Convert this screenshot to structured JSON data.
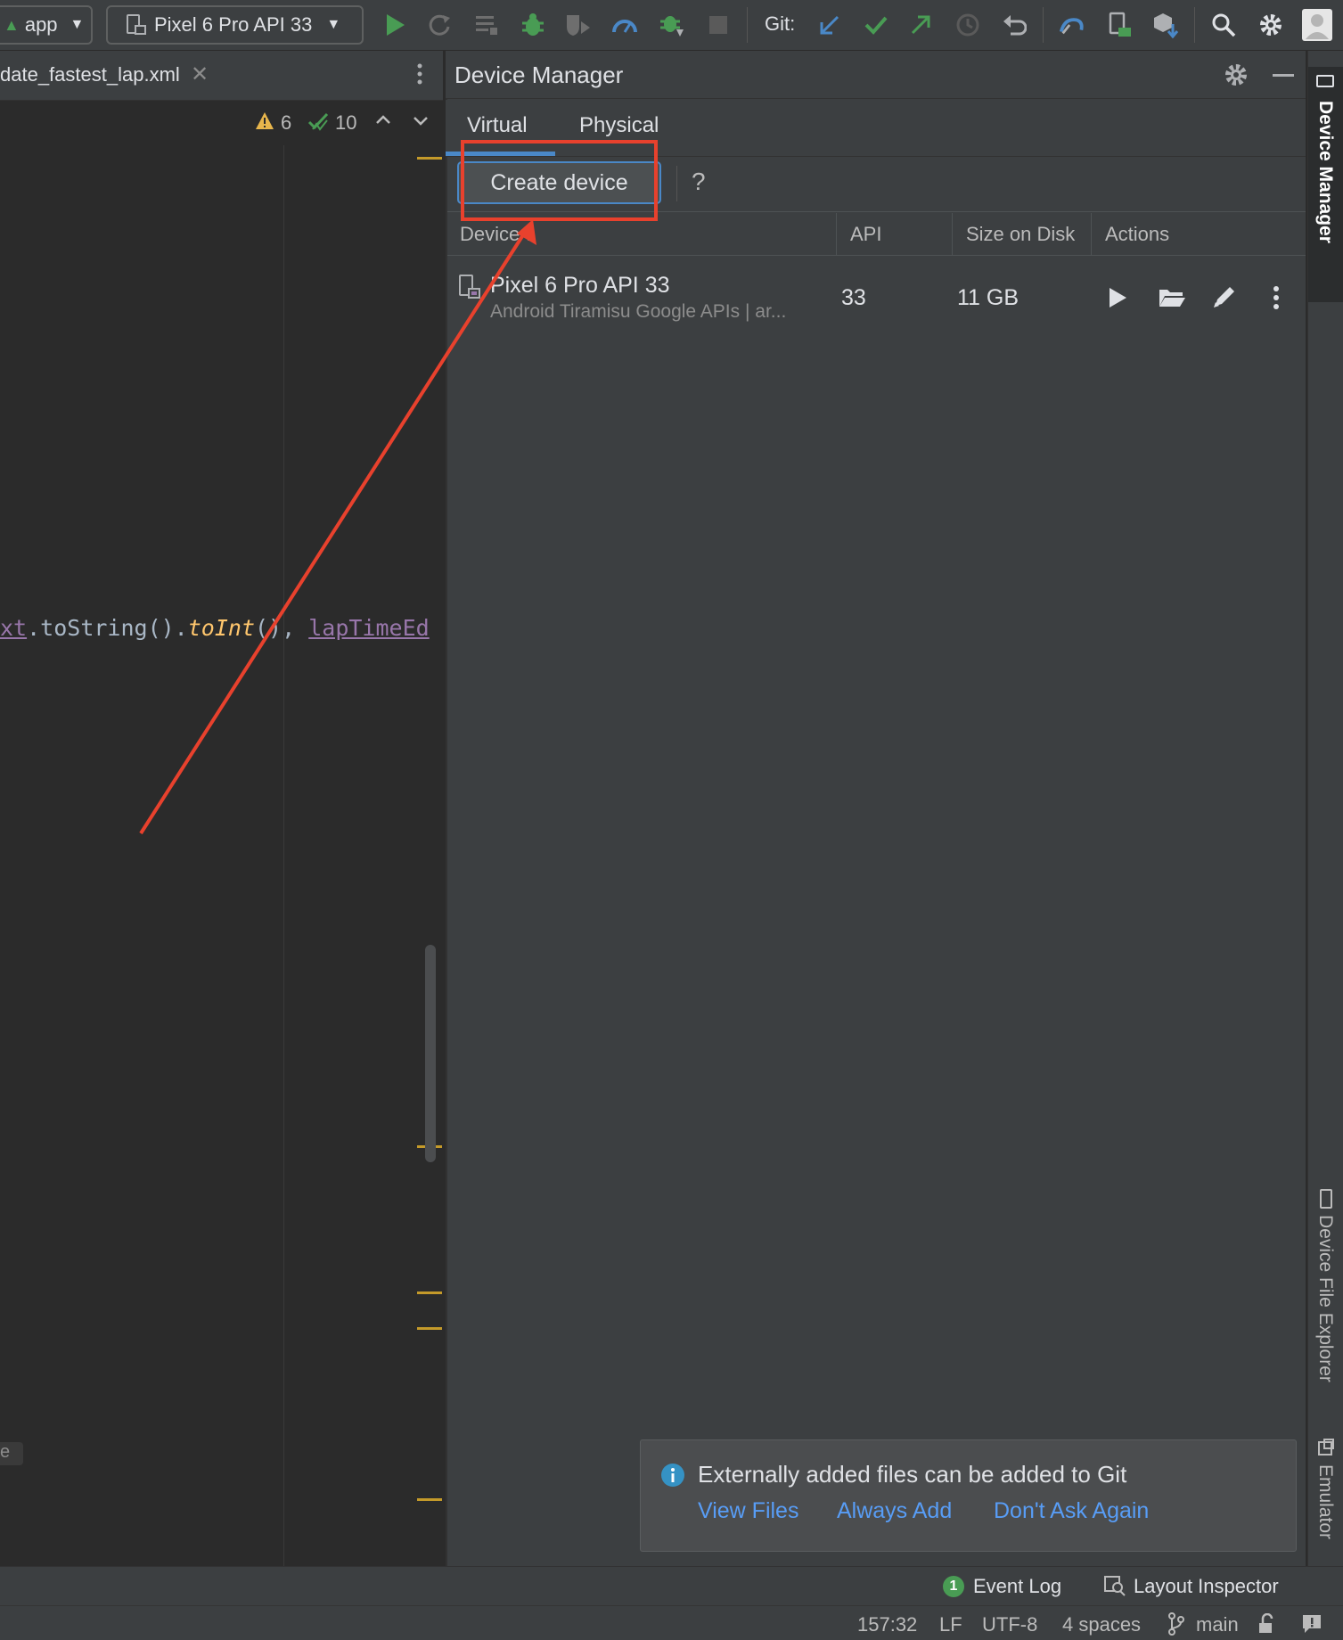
{
  "toolbar": {
    "run_config": "app",
    "device_combo": "Pixel 6 Pro API 33",
    "git_label": "Git:"
  },
  "editor": {
    "file_tab": "date_fastest_lap.xml",
    "warnings": "6",
    "checks": "10",
    "code_line": {
      "part1": "xt",
      "part2": ".toString().",
      "part3": "toInt",
      "part4": "(), ",
      "part5": "lapTimeEd"
    },
    "fold_label": "e"
  },
  "device_manager": {
    "title": "Device Manager",
    "tabs": [
      {
        "label": "Virtual",
        "active": true
      },
      {
        "label": "Physical",
        "active": false
      }
    ],
    "create_button": "Create device",
    "help": "?",
    "columns": {
      "device": "Device",
      "api": "API",
      "size": "Size on Disk",
      "actions": "Actions"
    },
    "rows": [
      {
        "name": "Pixel 6 Pro API 33",
        "subtitle": "Android Tiramisu Google APIs | ar...",
        "api": "33",
        "size": "11 GB"
      }
    ]
  },
  "notification": {
    "message": "Externally added files can be added to Git",
    "actions": [
      "View Files",
      "Always Add",
      "Don't Ask Again"
    ]
  },
  "side_tools": {
    "top": "Device Manager",
    "file_explorer": "Device File Explorer",
    "emulator": "Emulator"
  },
  "status": {
    "event_log_count": "1",
    "event_log": "Event Log",
    "layout_inspector": "Layout Inspector",
    "position": "157:32",
    "line_sep": "LF",
    "encoding": "UTF-8",
    "indent": "4 spaces",
    "branch": "main"
  },
  "colors": {
    "annotation_red": "#e8412d",
    "run_green": "#499c54",
    "link_blue": "#589df6",
    "accent_blue": "#4a88c7"
  }
}
